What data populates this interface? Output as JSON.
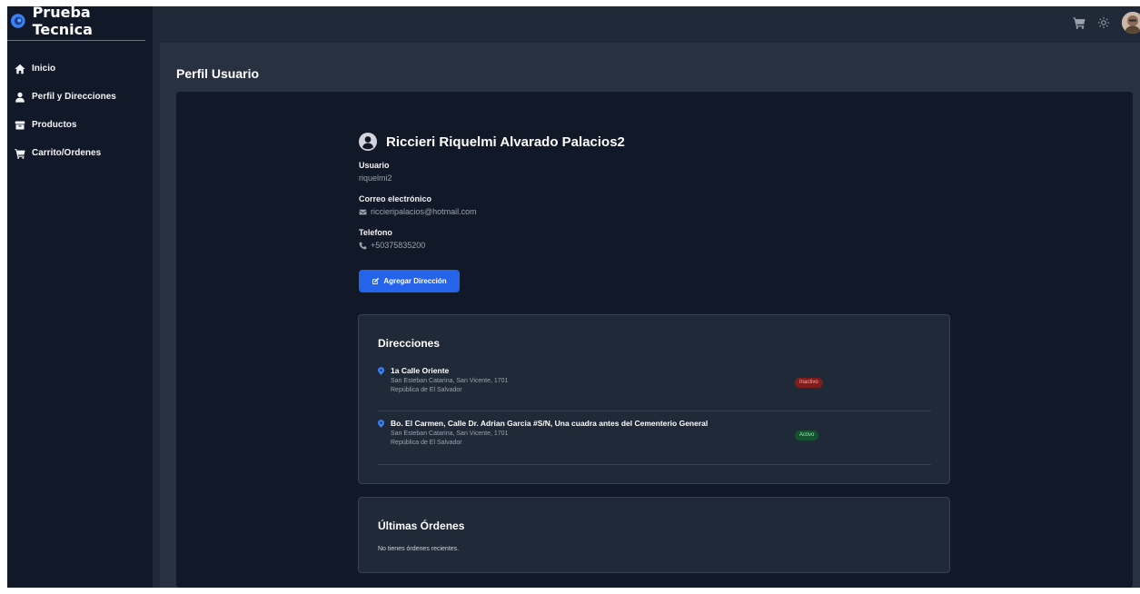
{
  "sidebar": {
    "brand": "Prueba Tecnica",
    "items": [
      {
        "label": "Inicio",
        "icon": "home-icon"
      },
      {
        "label": "Perfil y Direcciones",
        "icon": "user-icon"
      },
      {
        "label": "Productos",
        "icon": "box-icon"
      },
      {
        "label": "Carrito/Ordenes",
        "icon": "cart-icon"
      }
    ]
  },
  "topbar": {
    "icons": [
      "cart-icon",
      "sun-icon",
      "avatar"
    ]
  },
  "page": {
    "title": "Perfil Usuario"
  },
  "profile": {
    "name": "Riccieri Riquelmi Alvarado Palacios2",
    "username_label": "Usuario",
    "username": "riquelmi2",
    "email_label": "Correo electrónico",
    "email": "riccieripalacios@hotmail.com",
    "phone_label": "Telefono",
    "phone": "+50375835200",
    "add_address_button": "Agregar Dirección"
  },
  "addresses": {
    "title": "Direcciones",
    "items": [
      {
        "street": "1a Calle Oriente",
        "city_line": "San Esteban Catarina, San Vicente, 1701",
        "country": "República de El Salvador",
        "status": "Inactivo"
      },
      {
        "street": "Bo. El Carmen, Calle Dr. Adrian Garcia #S/N, Una cuadra antes del Cementerio General",
        "city_line": "San Esteban Catarina, San Vicente, 1701",
        "country": "República de El Salvador",
        "status": "Activo"
      }
    ]
  },
  "orders": {
    "title": "Últimas Órdenes",
    "empty_text": "No tienes órdenes recientes."
  },
  "colors": {
    "sidebar_bg": "#111827",
    "content_bg": "#28313f",
    "panel_bg": "#111827",
    "card_bg": "#1f2937",
    "accent": "#2563eb",
    "pin": "#3b82f6"
  }
}
